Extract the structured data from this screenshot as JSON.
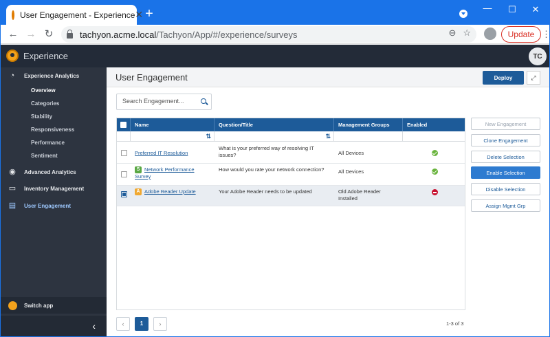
{
  "browser": {
    "tab_title": "User Engagement - Experience",
    "url_host": "tachyon.acme.local",
    "url_path": "/Tachyon/App/#/experience/surveys",
    "update_label": "Update"
  },
  "app": {
    "title": "Experience",
    "user_initials": "TC"
  },
  "sidebar": {
    "sections": [
      {
        "label": "Experience Analytics",
        "icon": "dashboard-icon"
      },
      {
        "label": "Advanced Analytics",
        "icon": "binoculars-icon"
      },
      {
        "label": "Inventory Management",
        "icon": "monitor-icon"
      },
      {
        "label": "User Engagement",
        "icon": "clipboard-icon"
      }
    ],
    "sub_items": [
      "Overview",
      "Categories",
      "Stability",
      "Responsiveness",
      "Performance",
      "Sentiment"
    ],
    "switch_app": "Switch app"
  },
  "main": {
    "title": "User Engagement",
    "deploy_label": "Deploy",
    "search_placeholder": "Search Engagement..."
  },
  "grid": {
    "columns": [
      "Name",
      "Question/Title",
      "Management Groups",
      "Enabled"
    ],
    "rows": [
      {
        "checked": false,
        "badge": "",
        "name": "Preferred IT Resolution",
        "question": "What is your preferred way of resolving IT issues?",
        "groups": "All Devices",
        "enabled": true
      },
      {
        "checked": false,
        "badge": "S",
        "badge_color": "#5aa845",
        "name": "Network Performance Survey",
        "question": "How would you rate your network connection?",
        "groups": "All Devices",
        "enabled": true
      },
      {
        "checked": true,
        "badge": "A",
        "badge_color": "#f0a830",
        "name": "Adobe Reader Update",
        "question": "Your Adobe Reader needs to be updated",
        "groups": "Old Adobe Reader Installed",
        "enabled": false
      }
    ]
  },
  "actions": {
    "new": "New Engagement",
    "clone": "Clone Engagement",
    "delete": "Delete Selection",
    "enable": "Enable Selection",
    "disable": "Disable Selection",
    "assign": "Assign Mgmt Grp"
  },
  "pager": {
    "current": "1",
    "summary": "1-3 of 3"
  },
  "colors": {
    "accent": "#1d5b99",
    "header_bg": "#232b38",
    "sidebar_bg": "#2d3440",
    "chrome": "#1a73e8"
  }
}
